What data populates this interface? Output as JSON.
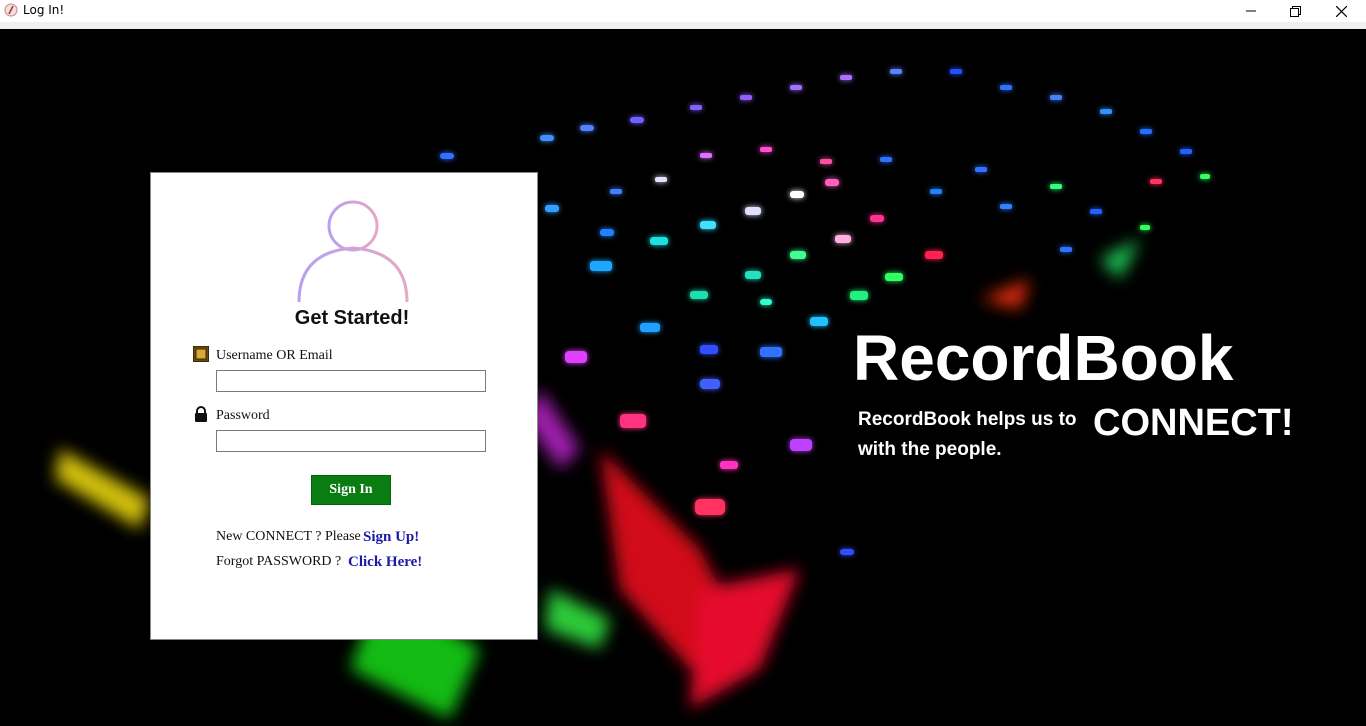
{
  "window": {
    "title": "Log In!",
    "icons": {
      "app": "feather-icon",
      "minimize": "minimize-icon",
      "maximize": "restore-icon",
      "close": "close-icon"
    }
  },
  "login": {
    "heading": "Get Started!",
    "username_label": "Username OR Email",
    "username_value": "",
    "password_label": "Password",
    "password_value": "",
    "signin_label": "Sign In",
    "new_prompt": "New CONNECT ? Please",
    "signup_link": "Sign Up!",
    "forgot_prompt": "Forgot PASSWORD ?",
    "forgot_link": "Click Here!"
  },
  "brand": {
    "name": "RecordBook",
    "tagline_line1": "RecordBook helps us to",
    "tagline_line2": "with the people.",
    "connect": "CONNECT!"
  },
  "colors": {
    "signin_bg": "#0a7d12",
    "link": "#1a1aa6",
    "avatar_gradient": [
      "#c9a6e8",
      "#e0a9c8"
    ]
  }
}
